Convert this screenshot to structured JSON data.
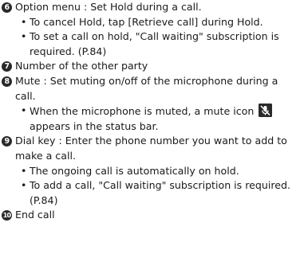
{
  "items": [
    {
      "number": "6",
      "text": "Option menu : Set Hold during a call.",
      "bullets": [
        "To cancel Hold, tap [Retrieve call] during Hold.",
        "To set a call on hold, \"Call waiting\" subscription is required. (P.84)"
      ]
    },
    {
      "number": "7",
      "text": "Number of the other party"
    },
    {
      "number": "8",
      "text": "Mute : Set muting on/off of the microphone during a call.",
      "bullets": [
        {
          "before": "When the microphone is muted, a mute icon",
          "icon": "mute-microphone-icon",
          "after": "appears in the status bar."
        }
      ]
    },
    {
      "number": "9",
      "text": "Dial key : Enter the phone number you want to add to make a call.",
      "bullets": [
        "The ongoing call is automatically on hold.",
        "To add a call, \"Call waiting\" subscription is required. (P.84)"
      ]
    },
    {
      "number": "10",
      "text": "End call"
    }
  ],
  "bullet_char": "•",
  "colors": {
    "text": "#1a1a1a",
    "number_badge": "#2a2a2a",
    "mute_icon_bg": "#2a2a2a"
  }
}
